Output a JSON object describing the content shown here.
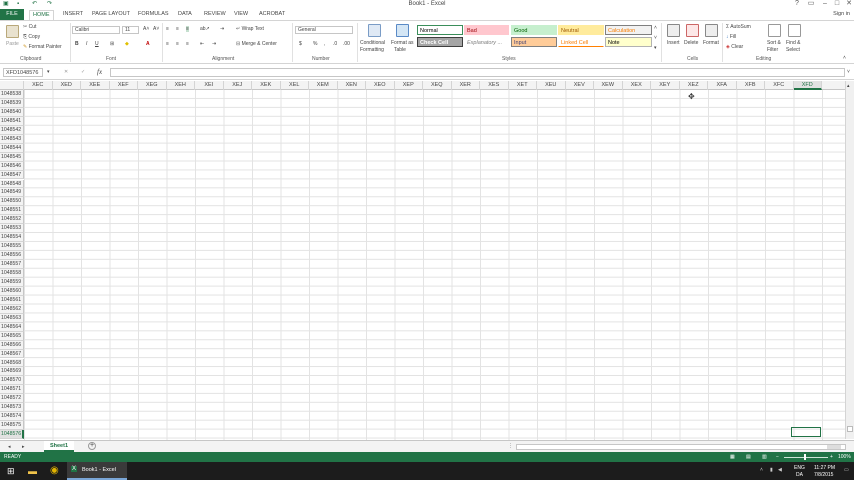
{
  "window": {
    "title": "Book1 - Excel",
    "sign_in": "Sign in"
  },
  "tabs": [
    "FILE",
    "HOME",
    "INSERT",
    "PAGE LAYOUT",
    "FORMULAS",
    "DATA",
    "REVIEW",
    "VIEW",
    "ACROBAT"
  ],
  "ribbon": {
    "clipboard": {
      "paste": "Paste",
      "cut": "Cut",
      "copy": "Copy",
      "format_painter": "Format Painter",
      "label": "Clipboard"
    },
    "font": {
      "name": "Calibri",
      "size": "11",
      "bold": "B",
      "italic": "I",
      "underline": "U",
      "label": "Font"
    },
    "alignment": {
      "wrap": "Wrap Text",
      "merge": "Merge & Center",
      "label": "Alignment"
    },
    "number": {
      "format": "General",
      "currency": "$",
      "percent": "%",
      "comma": ",",
      "label": "Number"
    },
    "styles": {
      "conditional": "Conditional",
      "formatting": "Formatting",
      "format_as": "Format as",
      "table": "Table",
      "label": "Styles",
      "cells": [
        "Normal",
        "Bad",
        "Good",
        "Neutral",
        "Calculation",
        "Check Cell",
        "Explanatory ...",
        "Input",
        "Linked Cell",
        "Note"
      ]
    },
    "cells": {
      "insert": "Insert",
      "delete": "Delete",
      "format": "Format",
      "label": "Cells"
    },
    "editing": {
      "autosum": "AutoSum",
      "fill": "Fill",
      "clear": "Clear",
      "sort": "Sort &",
      "filter": "Filter",
      "find": "Find &",
      "select": "Select",
      "label": "Editing"
    }
  },
  "formula_bar": {
    "name_box": "XFD1048576",
    "fx": "fx",
    "cancel": "✕",
    "enter": "✓"
  },
  "columns": [
    "XEC",
    "XED",
    "XEE",
    "XEF",
    "XEG",
    "XEH",
    "XEI",
    "XEJ",
    "XEK",
    "XEL",
    "XEM",
    "XEN",
    "XEO",
    "XEP",
    "XEQ",
    "XER",
    "XES",
    "XET",
    "XEU",
    "XEV",
    "XEW",
    "XEX",
    "XEY",
    "XEZ",
    "XFA",
    "XFB",
    "XFC",
    "XFD"
  ],
  "rows": [
    "1048538",
    "1048539",
    "1048540",
    "1048541",
    "1048542",
    "1048543",
    "1048544",
    "1048545",
    "1048546",
    "1048547",
    "1048548",
    "1048549",
    "1048550",
    "1048551",
    "1048552",
    "1048553",
    "1048554",
    "1048555",
    "1048556",
    "1048557",
    "1048558",
    "1048559",
    "1048560",
    "1048561",
    "1048562",
    "1048563",
    "1048564",
    "1048565",
    "1048566",
    "1048567",
    "1048568",
    "1048569",
    "1048570",
    "1048571",
    "1048572",
    "1048573",
    "1048574",
    "1048575",
    "1048576"
  ],
  "sheet": {
    "name": "Sheet1",
    "add": "+"
  },
  "status": {
    "ready": "READY",
    "zoom": "100%"
  },
  "taskbar": {
    "app": "Book1 - Excel",
    "lang1": "ENG",
    "lang2": "DA",
    "time": "11:27 PM",
    "date": "7/8/2015"
  }
}
